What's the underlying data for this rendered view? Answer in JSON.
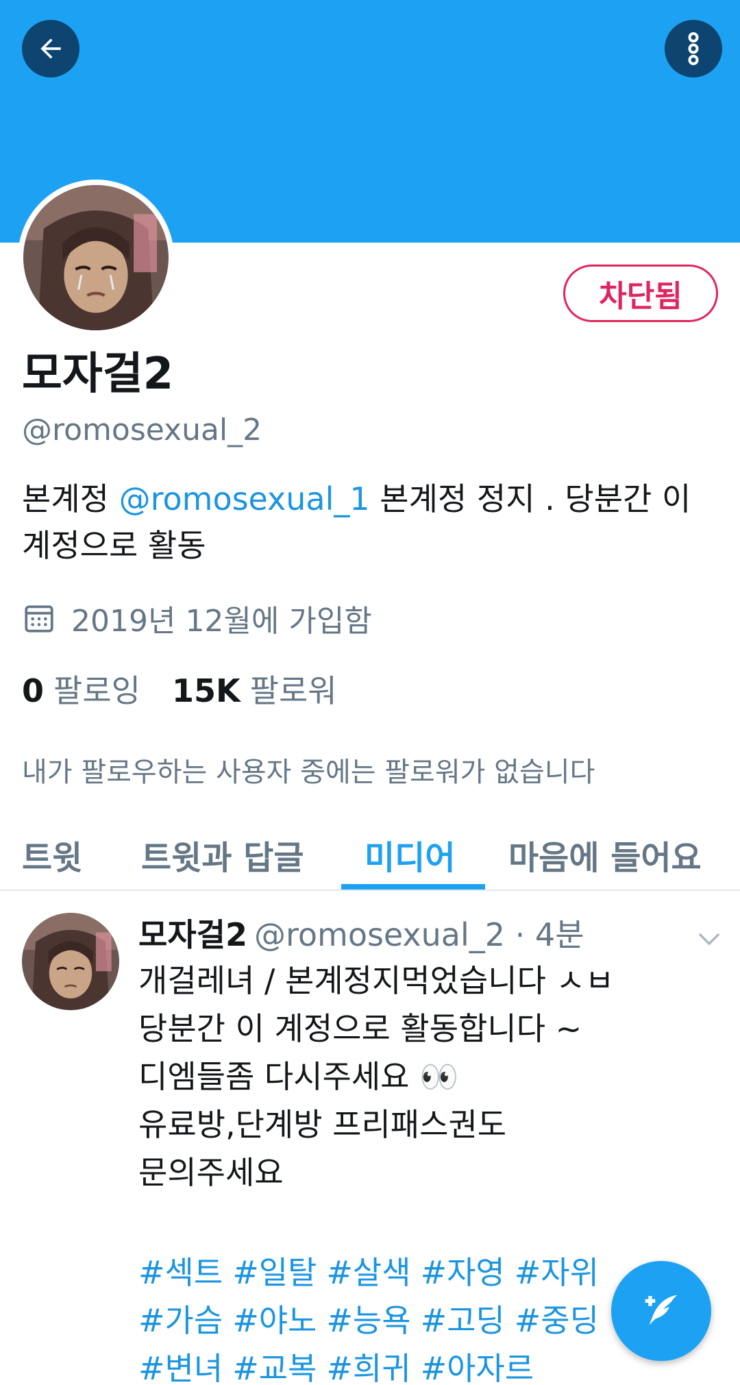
{
  "header": {
    "back_icon": "arrow-left-icon",
    "more_icon": "more-vertical-icon",
    "banner_color": "#1da1f2"
  },
  "profile": {
    "display_name": "모자걸2",
    "handle": "@romosexual_2",
    "blocked_label": "차단됨",
    "bio_prefix": "본계정 ",
    "bio_mention": "@romosexual_1",
    "bio_suffix": " 본계정 정지 . 당분간 이 계정으로 활동",
    "joined_text": "2019년 12월에 가입함",
    "following_count": "0",
    "following_label": "팔로잉",
    "followers_count": "15K",
    "followers_label": "팔로워",
    "no_mutual_followers": "내가 팔로우하는 사용자 중에는 팔로워가 없습니다"
  },
  "tabs": [
    {
      "label": "트윗",
      "active": false
    },
    {
      "label": "트윗과 답글",
      "active": false
    },
    {
      "label": "미디어",
      "active": true
    },
    {
      "label": "마음에 들어요",
      "active": false
    }
  ],
  "tweet": {
    "name": "모자걸2",
    "handle": "@romosexual_2",
    "separator": "·",
    "time": "4분",
    "text": "개걸레녀 / 본계정지먹었습니다 ㅅㅂ\n당분간 이 계정으로 활동합니다 ~\n디엠들좀 다시주세요 👀\n유료방,단계방 프리패스권도\n문의주세요",
    "hashtags_line1": [
      "#섹트",
      "#일탈",
      "#살색",
      "#자영",
      "#자위"
    ],
    "hashtags_line2": [
      "#가슴",
      "#야노",
      "#능욕",
      "#고딩",
      "#중딩"
    ],
    "hashtags_line3": [
      "#변녀",
      "#교복",
      "#희귀",
      "#아자르"
    ]
  },
  "fab": {
    "icon": "compose-tweet-icon"
  },
  "colors": {
    "accent": "#1da1f2",
    "link": "#1b95e0",
    "blocked": "#e0245e",
    "secondary_text": "#657786"
  }
}
